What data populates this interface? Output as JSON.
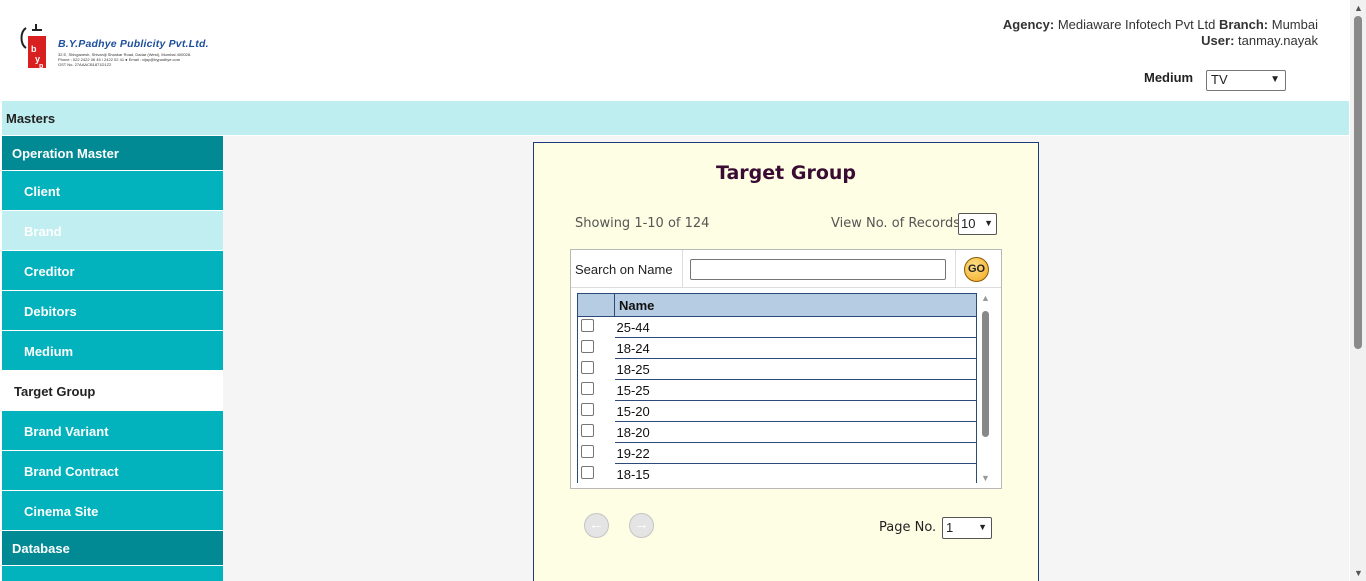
{
  "header": {
    "logo": {
      "title": "B.Y.Padhye Publicity Pvt.Ltd.",
      "line1": "32 E, Shivganesh, Shivaniji Shankar Road, Dadar (West), Mumbai 400028.",
      "line2": "Phone : 022 2422 06 45 / 2422 02 41 ● Email : vijay@bypadhye.com",
      "line3": "GST No. 27AAACB1871D1Z2"
    },
    "agency_label": "Agency:",
    "agency_value": "Mediaware Infotech Pvt Ltd",
    "branch_label": "Branch:",
    "branch_value": "Mumbai",
    "user_label": "User:",
    "user_value": "tanmay.nayak",
    "medium_label": "Medium",
    "medium_value": "TV"
  },
  "masters_bar": "Masters",
  "sidebar": {
    "operation_master": "Operation Master",
    "items": [
      {
        "label": "Client"
      },
      {
        "label": "Brand"
      },
      {
        "label": "Creditor"
      },
      {
        "label": "Debitors"
      },
      {
        "label": "Medium"
      },
      {
        "label": "Target Group"
      },
      {
        "label": "Brand Variant"
      },
      {
        "label": "Brand Contract"
      },
      {
        "label": "Cinema Site"
      }
    ],
    "database": "Database"
  },
  "panel": {
    "title": "Target Group",
    "showing": "Showing 1-10 of 124",
    "view_records_label": "View No. of Records:",
    "view_records_value": "10",
    "search_label": "Search on Name",
    "search_value": "",
    "go_label": "GO",
    "table": {
      "header_name": "Name",
      "rows": [
        "25-44",
        "18-24",
        "18-25",
        "15-25",
        "15-20",
        "18-20",
        "19-22",
        "18-15"
      ]
    },
    "page_label": "Page No.",
    "page_value": "1"
  }
}
